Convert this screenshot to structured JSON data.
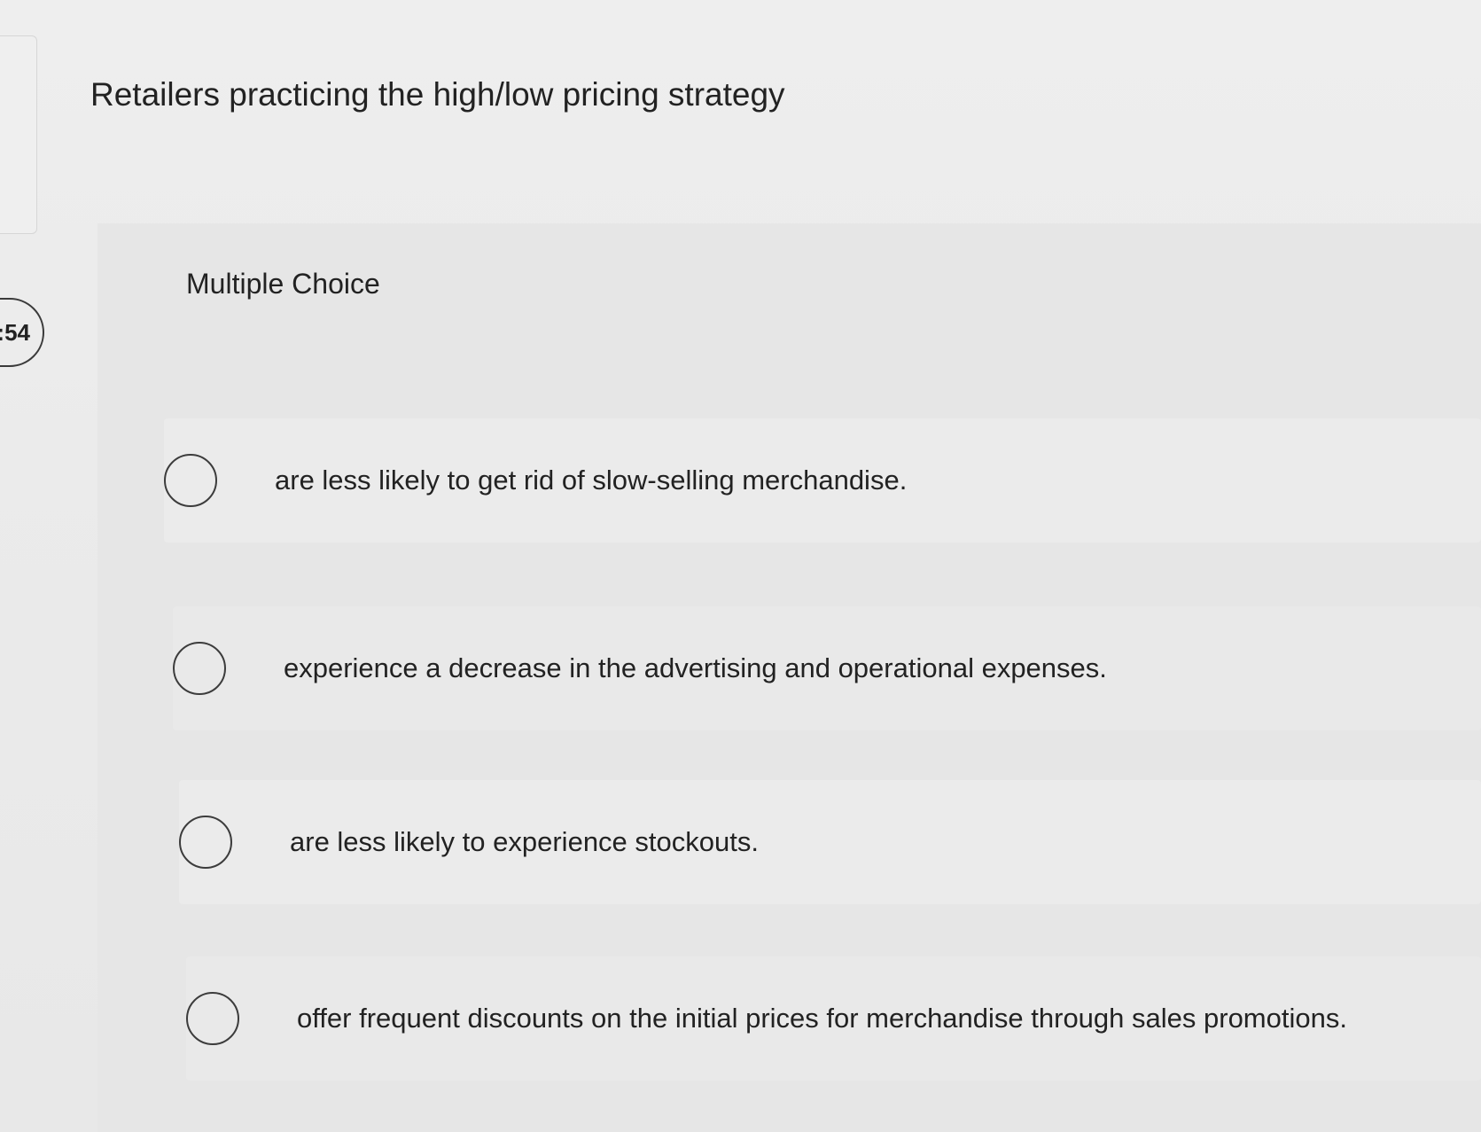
{
  "timer": {
    "text": ":54"
  },
  "question": {
    "prompt": "Retailers practicing the high/low pricing strategy"
  },
  "choices": {
    "type_label": "Multiple Choice",
    "options": [
      {
        "label": "are less likely to get rid of slow-selling merchandise.",
        "selected": false
      },
      {
        "label": "experience a decrease in the advertising and operational expenses.",
        "selected": false
      },
      {
        "label": "are less likely to experience stockouts.",
        "selected": false
      },
      {
        "label": "offer frequent discounts on the initial prices for merchandise through sales promotions.",
        "selected": false
      }
    ]
  },
  "colors": {
    "background": "#ebebeb",
    "panel": "#e6e6e6",
    "text": "#222222",
    "radio_border": "#3c3c3c"
  },
  "icons": {
    "radio": "radio-unchecked-icon"
  }
}
